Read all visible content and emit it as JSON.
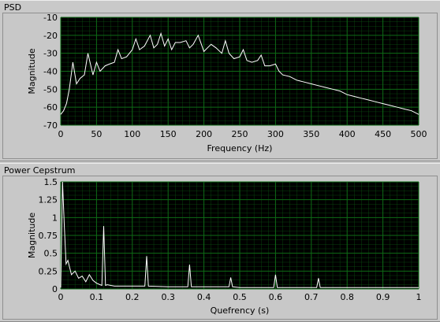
{
  "colors": {
    "panel_bg": "#c8c8c8",
    "plot_bg": "#000000",
    "grid": "#0e6b16",
    "trace": "#ffffff"
  },
  "panels": [
    {
      "title": "PSD"
    },
    {
      "title": "Power Cepstrum"
    }
  ],
  "chart_data": [
    {
      "type": "line",
      "title": "PSD",
      "xlabel": "Frequency (Hz)",
      "ylabel": "Magnitude",
      "xlim": [
        0,
        500
      ],
      "ylim": [
        -70,
        -10
      ],
      "x_ticks": [
        "0",
        "50",
        "100",
        "150",
        "200",
        "250",
        "300",
        "350",
        "400",
        "450",
        "500"
      ],
      "y_ticks": [
        "-10",
        "-20",
        "-30",
        "-40",
        "-50",
        "-60",
        "-70"
      ],
      "grid": true,
      "series": [
        {
          "x": [
            0,
            4,
            8,
            12,
            17,
            22,
            27,
            33,
            38,
            45,
            50,
            55,
            62,
            68,
            75,
            80,
            85,
            92,
            100,
            105,
            110,
            117,
            125,
            130,
            135,
            140,
            145,
            150,
            155,
            160,
            167,
            175,
            180,
            185,
            192,
            200,
            205,
            210,
            217,
            225,
            230,
            235,
            242,
            250,
            255,
            260,
            267,
            275,
            280,
            285,
            292,
            300,
            305,
            310,
            320,
            330,
            340,
            350,
            360,
            370,
            380,
            390,
            400,
            410,
            420,
            430,
            440,
            450,
            460,
            470,
            480,
            490,
            500
          ],
          "y": [
            -64,
            -62,
            -58,
            -50,
            -35,
            -47,
            -44,
            -42,
            -30,
            -42,
            -35,
            -40,
            -37,
            -36,
            -35,
            -28,
            -33,
            -32,
            -28,
            -22,
            -28,
            -26,
            -20,
            -27,
            -25,
            -19,
            -26,
            -22,
            -28,
            -24,
            -24,
            -23,
            -27,
            -25,
            -20,
            -29,
            -27,
            -25,
            -27,
            -30,
            -23,
            -30,
            -33,
            -32,
            -28,
            -34,
            -35,
            -34,
            -31,
            -37,
            -37,
            -36,
            -40,
            -42,
            -43,
            -45,
            -46,
            -47,
            -48,
            -49,
            -50,
            -51,
            -53,
            -54,
            -55,
            -56,
            -57,
            -58,
            -59,
            -60,
            -61,
            -62,
            -64
          ]
        }
      ]
    },
    {
      "type": "line",
      "title": "Power Cepstrum",
      "xlabel": "Quefrency (s)",
      "ylabel": "Magnitude",
      "xlim": [
        0,
        1
      ],
      "ylim": [
        0,
        1.5
      ],
      "x_ticks": [
        "0",
        "0.1",
        "0.2",
        "0.3",
        "0.4",
        "0.5",
        "0.6",
        "0.7",
        "0.8",
        "0.9",
        "1"
      ],
      "y_ticks": [
        "1.5",
        "1.25",
        "1",
        "0.75",
        "0.5",
        "0.25",
        "0"
      ],
      "grid": true,
      "series": [
        {
          "x": [
            0,
            0.005,
            0.01,
            0.015,
            0.02,
            0.03,
            0.04,
            0.05,
            0.06,
            0.07,
            0.08,
            0.09,
            0.1,
            0.11,
            0.115,
            0.12,
            0.125,
            0.13,
            0.15,
            0.2,
            0.235,
            0.24,
            0.245,
            0.3,
            0.355,
            0.36,
            0.365,
            0.4,
            0.47,
            0.475,
            0.48,
            0.5,
            0.595,
            0.6,
            0.605,
            0.65,
            0.715,
            0.72,
            0.725,
            0.8,
            0.9,
            1.0
          ],
          "y": [
            0.02,
            1.5,
            0.9,
            0.35,
            0.4,
            0.2,
            0.25,
            0.15,
            0.18,
            0.1,
            0.2,
            0.12,
            0.08,
            0.06,
            0.05,
            0.88,
            0.05,
            0.06,
            0.04,
            0.04,
            0.04,
            0.46,
            0.04,
            0.03,
            0.03,
            0.34,
            0.03,
            0.03,
            0.03,
            0.16,
            0.03,
            0.02,
            0.02,
            0.2,
            0.02,
            0.02,
            0.02,
            0.15,
            0.02,
            0.02,
            0.02,
            0.02
          ]
        }
      ]
    }
  ]
}
